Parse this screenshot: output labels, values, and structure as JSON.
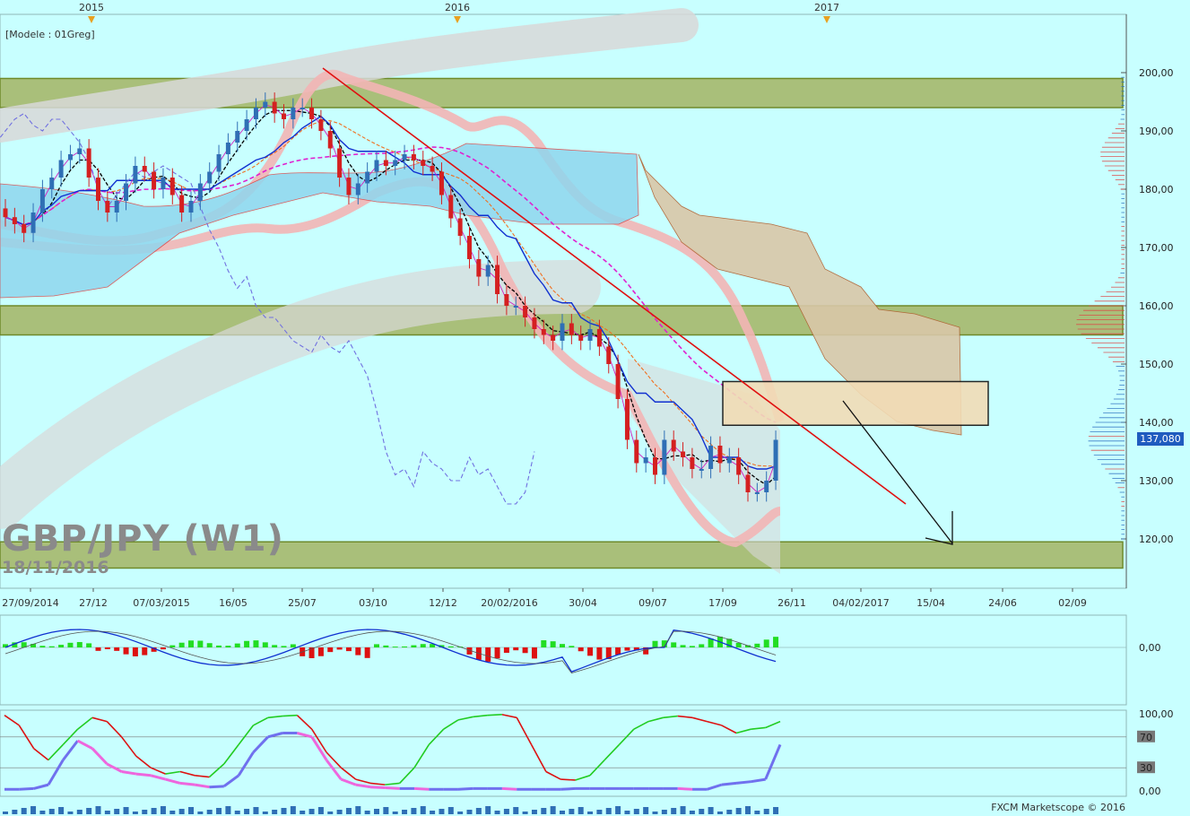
{
  "chart_title": "GBP/JPY (W1)",
  "chart_date": "18/11/2016",
  "model_label": "[Modele : 01Greg]",
  "footer": "FXCM Marketscope © 2016",
  "colors": {
    "background": "#c8ffff",
    "zone": "#a9bf7a",
    "zone_border": "#6f8a2a",
    "up": "#2f6fb5",
    "down": "#d42020",
    "trend": "#e01010",
    "box": "#f2dcb6"
  },
  "chart_data": [
    {
      "type": "candlestick",
      "title": "GBP/JPY (W1)",
      "ylim": [
        113,
        210
      ],
      "y_ticks": [
        120,
        130,
        140,
        150,
        160,
        170,
        180,
        190,
        200
      ],
      "y_tick_labels": [
        "120,00",
        "130,00",
        "140,00",
        "150,00",
        "160,00",
        "170,00",
        "180,00",
        "190,00",
        "200,00"
      ],
      "x_tick_labels": [
        "27/09/2014",
        "27/12",
        "07/03/2015",
        "16/05",
        "25/07",
        "03/10",
        "12/12",
        "20/02/2016",
        "30/04",
        "09/07",
        "17/09",
        "26/11",
        "04/02/2017",
        "15/04",
        "24/06",
        "02/09"
      ],
      "year_markers": [
        "2015",
        "2016",
        "2017"
      ],
      "last_price_label": "137,080",
      "support_resistance_zones": [
        [
          194,
          199
        ],
        [
          155,
          160
        ],
        [
          115,
          119.5
        ]
      ],
      "target_box": [
        139.5,
        147
      ],
      "close_series": [
        175.2,
        174,
        172.5,
        176,
        180,
        182,
        185,
        186,
        187,
        182,
        178,
        176,
        178,
        181,
        184,
        183,
        180,
        182,
        179,
        176,
        178,
        181,
        183,
        186,
        188,
        190,
        192,
        194,
        195,
        193,
        192,
        194,
        194,
        192,
        190,
        187,
        182,
        179,
        181,
        183,
        185,
        184,
        185,
        186,
        185,
        184,
        183,
        179,
        175,
        172,
        168,
        165,
        167,
        162,
        160,
        160,
        158,
        156,
        155,
        154,
        157,
        155,
        154,
        156,
        153,
        150,
        144,
        137,
        133,
        134,
        131,
        137,
        135,
        134,
        132,
        132,
        136,
        133,
        134,
        131,
        128,
        128,
        130,
        137
      ]
    },
    {
      "type": "histogram",
      "title": "MACD",
      "y_tick_labels": [
        "0,00"
      ]
    },
    {
      "type": "line",
      "title": "Stochastic",
      "ylim": [
        0,
        100
      ],
      "y_tick_labels": [
        "0,00",
        "30",
        "70",
        "100,00"
      ],
      "series": [
        {
          "values": [
            98,
            85,
            55,
            40,
            60,
            80,
            95,
            90,
            70,
            45,
            30,
            22,
            25,
            20,
            18,
            35,
            60,
            85,
            95,
            97,
            98,
            80,
            50,
            30,
            15,
            10,
            8,
            10,
            30,
            60,
            80,
            92,
            96,
            98,
            99,
            95,
            60,
            25,
            15,
            14,
            20,
            40,
            60,
            80,
            90,
            95,
            97,
            95,
            90,
            85,
            75,
            80,
            82,
            90
          ]
        },
        {
          "values": [
            2,
            2,
            3,
            8,
            40,
            65,
            55,
            35,
            25,
            22,
            20,
            15,
            10,
            8,
            5,
            6,
            20,
            50,
            70,
            75,
            75,
            70,
            40,
            15,
            8,
            5,
            4,
            3,
            3,
            2,
            2,
            2,
            3,
            3,
            3,
            2,
            2,
            2,
            2,
            3,
            3,
            3,
            3,
            3,
            3,
            3,
            3,
            2,
            2,
            8,
            10,
            12,
            15,
            60
          ]
        }
      ]
    }
  ]
}
